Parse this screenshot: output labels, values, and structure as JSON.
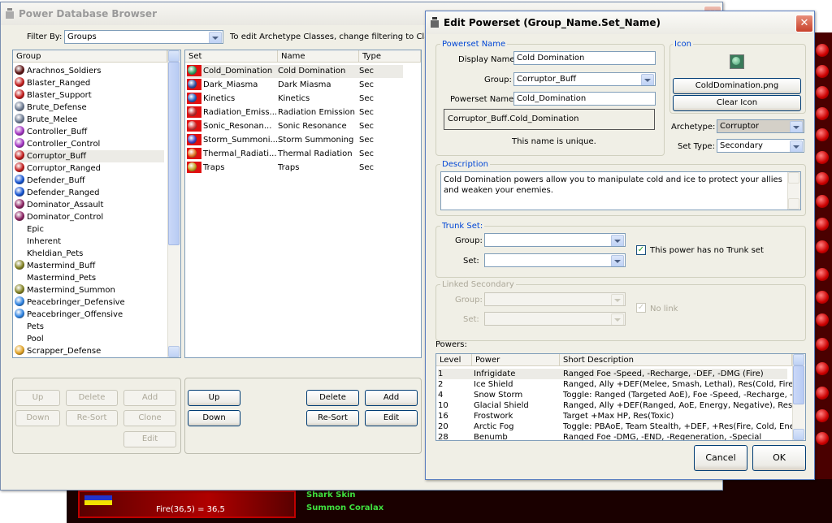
{
  "browser": {
    "title": "Power Database Browser",
    "filter_label": "Filter By:",
    "filter_value": "Groups",
    "filter_hint": "To edit Archetype Classes, change filtering to Classes",
    "group_header": "Group",
    "groups": [
      {
        "label": "Arachnos_Soldiers",
        "icon": "arachnos-icon",
        "color": "#5a1010"
      },
      {
        "label": "Blaster_Ranged",
        "icon": "blaster-icon",
        "color": "#c01818"
      },
      {
        "label": "Blaster_Support",
        "icon": "blaster-icon",
        "color": "#c01818"
      },
      {
        "label": "Brute_Defense",
        "icon": "brute-icon",
        "color": "#6a7890"
      },
      {
        "label": "Brute_Melee",
        "icon": "brute-icon",
        "color": "#6a7890"
      },
      {
        "label": "Controller_Buff",
        "icon": "controller-icon",
        "color": "#a030c0"
      },
      {
        "label": "Controller_Control",
        "icon": "controller-icon",
        "color": "#a030c0"
      },
      {
        "label": "Corruptor_Buff",
        "icon": "corruptor-icon",
        "color": "#c01818"
      },
      {
        "label": "Corruptor_Ranged",
        "icon": "corruptor-icon",
        "color": "#c01818"
      },
      {
        "label": "Defender_Buff",
        "icon": "defender-icon",
        "color": "#1050d0"
      },
      {
        "label": "Defender_Ranged",
        "icon": "defender-icon",
        "color": "#1050d0"
      },
      {
        "label": "Dominator_Assault",
        "icon": "dominator-icon",
        "color": "#8a2060"
      },
      {
        "label": "Dominator_Control",
        "icon": "dominator-icon",
        "color": "#8a2060"
      },
      {
        "label": "Epic",
        "icon": "",
        "color": ""
      },
      {
        "label": "Inherent",
        "icon": "",
        "color": ""
      },
      {
        "label": "Kheldian_Pets",
        "icon": "",
        "color": ""
      },
      {
        "label": "Mastermind_Buff",
        "icon": "mastermind-icon",
        "color": "#808020"
      },
      {
        "label": "Mastermind_Pets",
        "icon": "",
        "color": ""
      },
      {
        "label": "Mastermind_Summon",
        "icon": "mastermind-icon",
        "color": "#808020"
      },
      {
        "label": "Peacebringer_Defensive",
        "icon": "peacebringer-icon",
        "color": "#2a80e0"
      },
      {
        "label": "Peacebringer_Offensive",
        "icon": "peacebringer-icon",
        "color": "#2a80e0"
      },
      {
        "label": "Pets",
        "icon": "",
        "color": ""
      },
      {
        "label": "Pool",
        "icon": "",
        "color": ""
      },
      {
        "label": "Scrapper_Defense",
        "icon": "scrapper-icon",
        "color": "#e0a020"
      }
    ],
    "set_headers": {
      "set": "Set",
      "name": "Name",
      "type": "Type"
    },
    "sets": [
      {
        "set": "Cold_Domination",
        "name": "Cold Domination",
        "type": "Sec",
        "color": "#30a060"
      },
      {
        "set": "Dark_Miasma",
        "name": "Dark Miasma",
        "type": "Sec",
        "color": "#3050a0"
      },
      {
        "set": "Kinetics",
        "name": "Kinetics",
        "type": "Sec",
        "color": "#2060c0"
      },
      {
        "set": "Radiation_Emiss...",
        "name": "Radiation Emission",
        "type": "Sec",
        "color": "#c03030"
      },
      {
        "set": "Sonic_Resonan...",
        "name": "Sonic Resonance",
        "type": "Sec",
        "color": "#d04040"
      },
      {
        "set": "Storm_Summoni...",
        "name": "Storm Summoning",
        "type": "Sec",
        "color": "#4040c0"
      },
      {
        "set": "Thermal_Radiati...",
        "name": "Thermal Radiation",
        "type": "Sec",
        "color": "#e07020"
      },
      {
        "set": "Traps",
        "name": "Traps",
        "type": "Sec",
        "color": "#c0a020"
      }
    ],
    "left_buttons": {
      "up": "Up",
      "delete": "Delete",
      "add": "Add",
      "down": "Down",
      "resort": "Re-Sort",
      "clone": "Clone",
      "edit": "Edit"
    },
    "right_buttons": {
      "up": "Up",
      "down": "Down",
      "delete": "Delete",
      "add": "Add",
      "resort": "Re-Sort",
      "edit": "Edit"
    }
  },
  "editor": {
    "title": "Edit Powerset (Group_Name.Set_Name)",
    "powerset_name_label": "Powerset Name",
    "display_name_label": "Display Name:",
    "display_name": "Cold Domination",
    "group_label": "Group:",
    "group_value": "Corruptor_Buff",
    "powerset_name_field_label": "Powerset Name:",
    "powerset_name_value": "Cold_Domination",
    "full_name": "Corruptor_Buff.Cold_Domination",
    "unique_msg": "This name is unique.",
    "icon_label": "Icon",
    "icon_file": "ColdDomination.png",
    "clear_icon": "Clear Icon",
    "archetype_label": "Archetype:",
    "archetype_value": "Corruptor",
    "settype_label": "Set Type:",
    "settype_value": "Secondary",
    "description_label": "Description",
    "description": "Cold Domination powers allow you to manipulate cold and ice to protect your allies and weaken your enemies.",
    "trunk_label": "Trunk Set:",
    "trunk_group_label": "Group:",
    "trunk_set_label": "Set:",
    "no_trunk_label": "This power has no Trunk set",
    "linked_label": "Linked Secondary",
    "linked_group_label": "Group:",
    "linked_set_label": "Set:",
    "no_link_label": "No link",
    "powers_label": "Powers:",
    "powers_headers": {
      "level": "Level",
      "power": "Power",
      "desc": "Short Description"
    },
    "powers": [
      {
        "level": "1",
        "power": "Infrigidate",
        "desc": "Ranged Foe -Speed, -Recharge, -DEF, -DMG (Fire)"
      },
      {
        "level": "2",
        "power": "Ice Shield",
        "desc": "Ranged, Ally +DEF(Melee, Smash, Lethal), Res(Cold, Fire)"
      },
      {
        "level": "4",
        "power": "Snow Storm",
        "desc": "Toggle: Ranged (Targeted AoE), Foe -Speed, -Recharge, -Fly"
      },
      {
        "level": "10",
        "power": "Glacial Shield",
        "desc": "Ranged, Ally +DEF(Ranged, AoE, Energy, Negative), Res(Col..."
      },
      {
        "level": "16",
        "power": "Frostwork",
        "desc": "Target +Max HP, Res(Toxic)"
      },
      {
        "level": "20",
        "power": "Arctic Fog",
        "desc": "Toggle: PBAoE, Team Stealth, +DEF, +Res(Fire, Cold, Energy..."
      },
      {
        "level": "28",
        "power": "Benumb",
        "desc": "Ranged Foe -DMG, -END, -Regeneration, -Special"
      }
    ],
    "cancel": "Cancel",
    "ok": "OK"
  },
  "game": {
    "fire_text": "Fire(36,5) = 36,5",
    "shark_skin": "Shark Skin",
    "summon_coralax": "Summon Coralax"
  }
}
